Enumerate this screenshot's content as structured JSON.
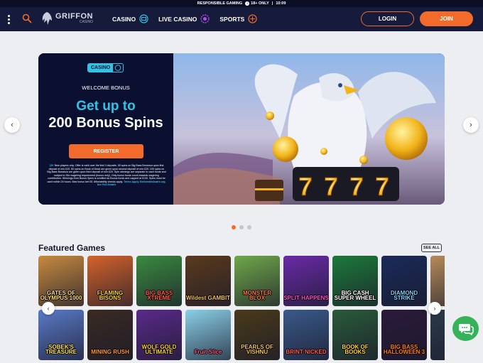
{
  "topbar": {
    "responsible": "RESPONSIBLE GAMING",
    "age": "18+ ONLY",
    "sep": "|",
    "time": "10:09"
  },
  "header": {
    "logo_main": "GRIFFON",
    "logo_sub": "CASINO",
    "nav": [
      {
        "label": "CASINO",
        "icon": "slot-icon"
      },
      {
        "label": "LIVE CASINO",
        "icon": "chip-icon"
      },
      {
        "label": "SPORTS",
        "icon": "ball-icon"
      }
    ],
    "login": "LOGIN",
    "join": "JOIN",
    "colors": {
      "bg": "#161b3c",
      "accent": "#f26b2a"
    }
  },
  "hero": {
    "badge": "CASINO",
    "welcome": "WELCOME BONUS",
    "headline": "Get up to",
    "subheadline": "200 Bonus Spins",
    "cta": "REGISTER",
    "terms_prefix": "18+",
    "terms": "New players only. Offer is valid over the first 3 deposits. 50 spins on Big Bass Bonanza upon first deposit of min £20. 50 spins on Book of Dead are given upon second deposit of min £20. 100 spins on Big Bass Bonanza are given upon third deposit of min £20. Spin winnings are separate to cash funds and subject to 35x wagering requirement (bonus only). Only bonus funds count towards wagering contribution. Winnings from Bonus Spins is credited as Bonus funds and capped at £100. Spins must be used within 24 hours. Max bonus bet £5. Affordability checks apply.",
    "terms_links": "Terms Apply. BeGambleAware.org.",
    "terms_more": "See Full Details",
    "slides_total": 3,
    "slide_active": 1,
    "colors": {
      "cyan": "#2ec4e8",
      "panel": "#0c1030"
    }
  },
  "featured": {
    "title": "Featured Games",
    "see_all": "SEE ALL",
    "row1": [
      {
        "name": "GATES OF OLYMPUS 1000",
        "bg": "#c78a3f",
        "fg": "#ffe27a"
      },
      {
        "name": "FLAMING BISONS",
        "bg": "#d4632a",
        "fg": "#ffd43a"
      },
      {
        "name": "BIG BASS XTREME",
        "bg": "#3a8a3f",
        "fg": "#ff5a3c"
      },
      {
        "name": "Wildest GAMBIT",
        "bg": "#5a3a1c",
        "fg": "#f2c45a"
      },
      {
        "name": "MONSTER BLOX",
        "bg": "#6fa84a",
        "fg": "#ff7a2a"
      },
      {
        "name": "SPLIT HAPPENS",
        "bg": "#6a2aa8",
        "fg": "#ff4ad0"
      },
      {
        "name": "BIG CASH SUPER WHEEL",
        "bg": "#1d7a3a",
        "fg": "#ffffff"
      },
      {
        "name": "DIAMOND STRIKE",
        "bg": "#1a2a5a",
        "fg": "#7ad0ff"
      },
      {
        "name": "",
        "bg": "#b58a5a",
        "fg": "#ffffff"
      }
    ],
    "row2": [
      {
        "name": "SOBEK'S TREASURE",
        "bg": "#5a7ac8",
        "fg": "#ffe45a"
      },
      {
        "name": "MINING RUSH",
        "bg": "#3a2a22",
        "fg": "#ff9a3a"
      },
      {
        "name": "WOLF GOLD ULTIMATE",
        "bg": "#5a2a8a",
        "fg": "#ffcf3a"
      },
      {
        "name": "Fruit Slice",
        "bg": "#8ad0e8",
        "fg": "#ff5a8a"
      },
      {
        "name": "PEARLS OF VISHNU",
        "bg": "#4a3a1a",
        "fg": "#f2c45a"
      },
      {
        "name": "BRINT NICKED",
        "bg": "#3a5a8a",
        "fg": "#ff5a5a"
      },
      {
        "name": "BOOK OF BOOKS",
        "bg": "#2a5a3a",
        "fg": "#ffd43a"
      },
      {
        "name": "BIG BASS HALLOWEEN 3",
        "bg": "#2a1a3a",
        "fg": "#ff7a1a"
      },
      {
        "name": "",
        "bg": "#2a3a4a",
        "fg": "#ffffff"
      }
    ]
  }
}
